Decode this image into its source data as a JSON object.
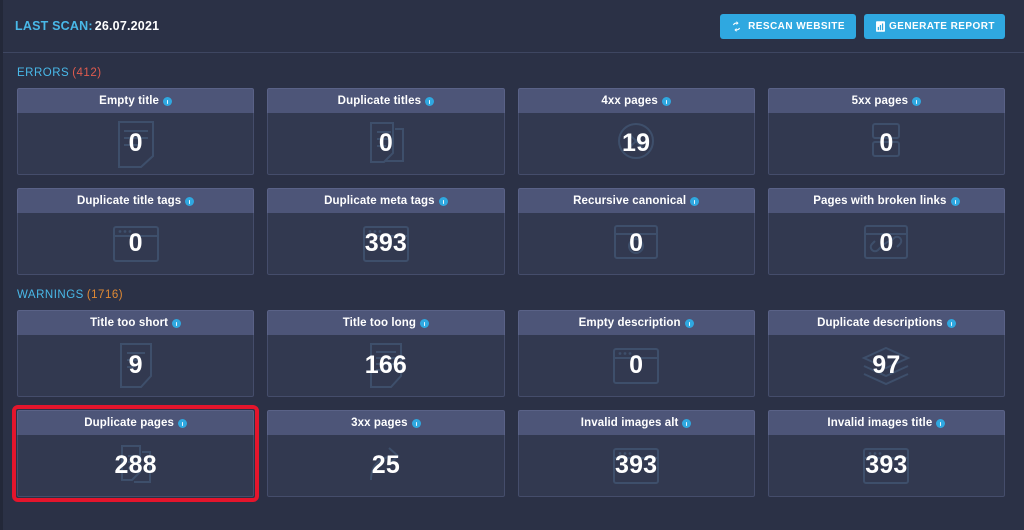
{
  "topbar": {
    "last_scan_label": "LAST SCAN:",
    "last_scan_date": "26.07.2021",
    "rescan_button": "Rescan website",
    "rescan_icon": "refresh-icon",
    "generate_button": "Generate report",
    "generate_icon": "report-document-icon"
  },
  "theme": {
    "page_background": "#2b3146",
    "card_header_background": "#4d5578",
    "card_body_background": "#323950",
    "accent_blue": "#2fa8e0",
    "label_blue": "#49b8e8",
    "error_red": "#e05b4e",
    "warning_orange": "#e08a34",
    "highlight_red": "#e4152c",
    "value_white": "#ffffff"
  },
  "sections": [
    {
      "name": "ERRORS",
      "count": "(412)",
      "type": "errors",
      "cards": [
        {
          "title": "Empty title",
          "value": "0",
          "info_icon": "info-icon",
          "watermark": "page-title-icon",
          "highlight": false
        },
        {
          "title": "Duplicate titles",
          "value": "0",
          "info_icon": "info-icon",
          "watermark": "duplicate-page-icon",
          "highlight": false
        },
        {
          "title": "4xx pages",
          "value": "19",
          "info_icon": "info-icon",
          "watermark": "error-4xx-icon",
          "highlight": false
        },
        {
          "title": "5xx pages",
          "value": "0",
          "info_icon": "info-icon",
          "watermark": "server-5xx-icon",
          "highlight": false
        },
        {
          "title": "Duplicate title tags",
          "value": "0",
          "info_icon": "info-icon",
          "watermark": "browser-window-icon",
          "highlight": false
        },
        {
          "title": "Duplicate meta tags",
          "value": "393",
          "info_icon": "info-icon",
          "watermark": "browser-window-icon",
          "highlight": false
        },
        {
          "title": "Recursive canonical",
          "value": "0",
          "info_icon": "info-icon",
          "watermark": "canonical-loop-icon",
          "highlight": false
        },
        {
          "title": "Pages with broken links",
          "value": "0",
          "info_icon": "info-icon",
          "watermark": "broken-link-icon",
          "highlight": false
        }
      ]
    },
    {
      "name": "WARNINGS",
      "count": "(1716)",
      "type": "warnings",
      "cards": [
        {
          "title": "Title too short",
          "value": "9",
          "info_icon": "info-icon",
          "watermark": "short-title-icon",
          "highlight": false
        },
        {
          "title": "Title too long",
          "value": "166",
          "info_icon": "info-icon",
          "watermark": "long-title-icon",
          "highlight": false
        },
        {
          "title": "Empty description",
          "value": "0",
          "info_icon": "info-icon",
          "watermark": "browser-window-icon",
          "highlight": false
        },
        {
          "title": "Duplicate descriptions",
          "value": "97",
          "info_icon": "info-icon",
          "watermark": "layers-icon",
          "highlight": false
        },
        {
          "title": "Duplicate pages",
          "value": "288",
          "info_icon": "info-icon",
          "watermark": "duplicate-copy-icon",
          "highlight": true
        },
        {
          "title": "3xx pages",
          "value": "25",
          "info_icon": "info-icon",
          "watermark": "redirect-arrow-icon",
          "highlight": false
        },
        {
          "title": "Invalid images alt",
          "value": "393",
          "info_icon": "info-icon",
          "watermark": "browser-window-icon",
          "highlight": false
        },
        {
          "title": "Invalid images title",
          "value": "393",
          "info_icon": "info-icon",
          "watermark": "browser-window-icon",
          "highlight": false
        }
      ]
    }
  ]
}
